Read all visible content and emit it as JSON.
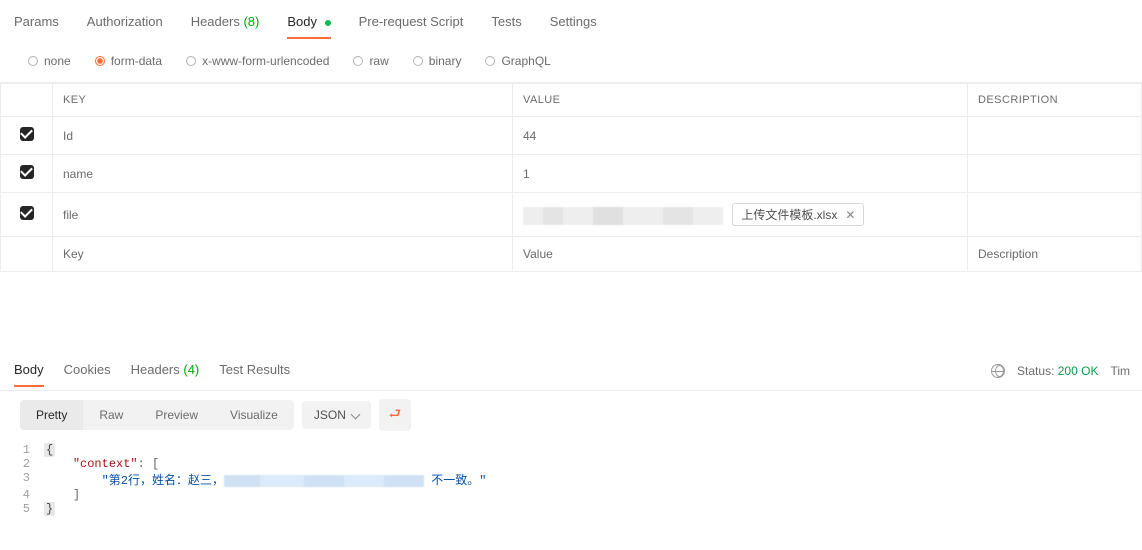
{
  "request_tabs": {
    "params": "Params",
    "auth": "Authorization",
    "headers_label": "Headers",
    "headers_count": "(8)",
    "body": "Body",
    "prereq": "Pre-request Script",
    "tests": "Tests",
    "settings": "Settings"
  },
  "body_types": {
    "none": "none",
    "form_data": "form-data",
    "urlencoded": "x-www-form-urlencoded",
    "raw": "raw",
    "binary": "binary",
    "graphql": "GraphQL"
  },
  "kv_headers": {
    "key": "KEY",
    "value": "VALUE",
    "desc": "DESCRIPTION"
  },
  "rows": [
    {
      "key": "Id",
      "value": "44"
    },
    {
      "key": "name",
      "value": "1"
    },
    {
      "key": "file",
      "file_name": "上传文件模板.xlsx"
    }
  ],
  "placeholders": {
    "key": "Key",
    "value": "Value",
    "desc": "Description"
  },
  "response_tabs": {
    "body": "Body",
    "cookies": "Cookies",
    "headers_label": "Headers",
    "headers_count": "(4)",
    "tests": "Test Results"
  },
  "status": {
    "label": "Status:",
    "code": "200 OK",
    "time_label": "Tim"
  },
  "view_modes": {
    "pretty": "Pretty",
    "raw": "Raw",
    "preview": "Preview",
    "visualize": "Visualize"
  },
  "format": "JSON",
  "json": {
    "l1": "{",
    "l2_indent": "    ",
    "l2_key": "\"context\"",
    "l2_after": ": [",
    "l3_indent": "        ",
    "l3_a": "\"第2行，姓名：赵三，",
    "l3_b": " 不一致。\"",
    "l4_indent": "    ",
    "l4": "]",
    "l5": "}"
  }
}
